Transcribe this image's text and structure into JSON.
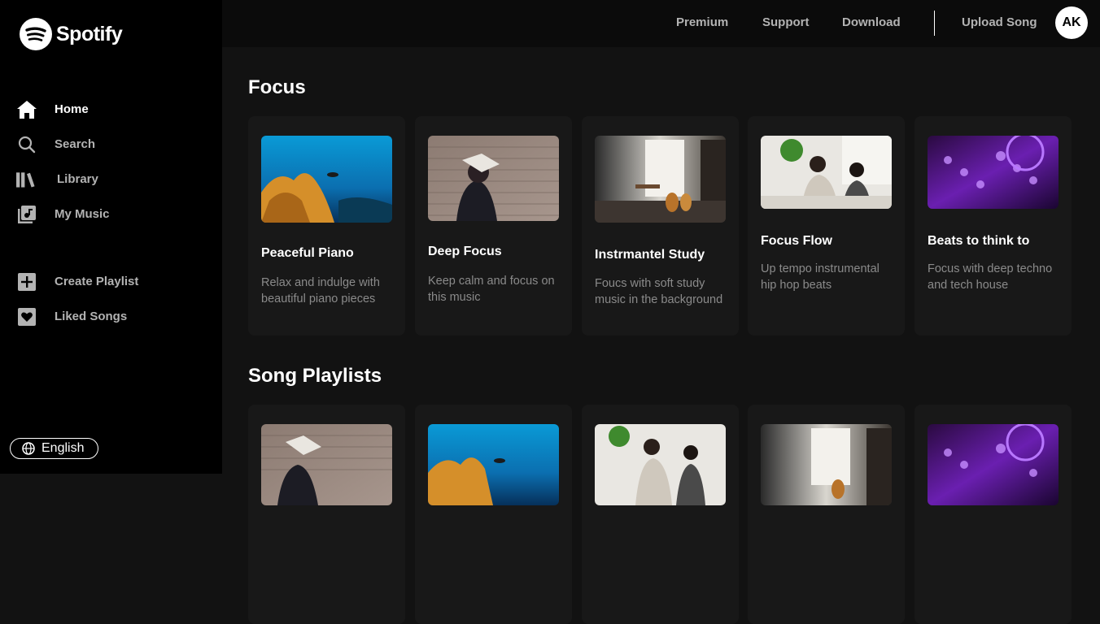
{
  "brand": {
    "name": "Spotify"
  },
  "sidebar": {
    "nav": [
      {
        "label": "Home",
        "icon": "home-icon",
        "active": true
      },
      {
        "label": "Search",
        "icon": "search-icon",
        "active": false
      },
      {
        "label": "Library",
        "icon": "library-icon",
        "active": false
      },
      {
        "label": "My Music",
        "icon": "my-music-icon",
        "active": false
      }
    ],
    "actions": [
      {
        "label": "Create Playlist",
        "icon": "plus-icon"
      },
      {
        "label": "Liked Songs",
        "icon": "heart-icon"
      }
    ],
    "language": "English"
  },
  "topbar": {
    "premium": "Premium",
    "support": "Support",
    "download": "Download",
    "upload": "Upload Song",
    "avatar_initials": "AK"
  },
  "focus": {
    "title": "Focus",
    "cards": [
      {
        "title": "Peaceful Piano",
        "desc": "Relax and indulge with beautiful piano pieces",
        "image": "underwater-reef"
      },
      {
        "title": "Deep Focus",
        "desc": "Keep calm and focus on this music",
        "image": "person-with-book-brick-wall"
      },
      {
        "title": "Instrmantel Study",
        "desc": "Foucs with soft study music in the background",
        "image": "guitars-by-window"
      },
      {
        "title": "Focus Flow",
        "desc": "Up tempo instrumental hip hop beats",
        "image": "two-people-studying"
      },
      {
        "title": "Beats to think to",
        "desc": "Focus with deep techno and tech house",
        "image": "purple-dj-mixer"
      }
    ]
  },
  "playlists": {
    "title": "Song Playlists",
    "cards": [
      {
        "image": "person-with-book-brick-wall"
      },
      {
        "image": "underwater-reef"
      },
      {
        "image": "two-people-studying"
      },
      {
        "image": "guitars-by-window"
      },
      {
        "image": "purple-dj-mixer"
      }
    ]
  },
  "colors": {
    "accent": "#ffffff",
    "background": "#121212",
    "sidebar": "#000000",
    "card": "#181818",
    "muted_text": "#8a8a8a"
  }
}
